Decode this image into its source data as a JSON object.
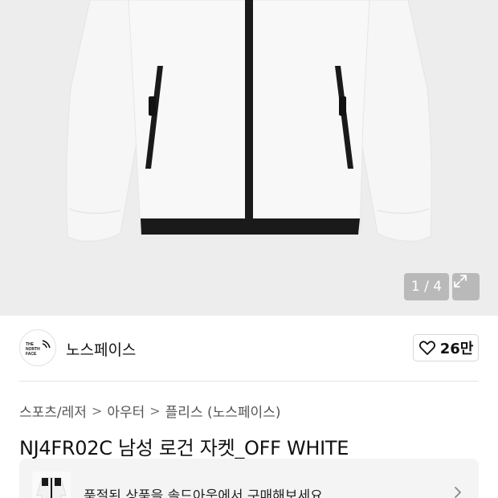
{
  "gallery": {
    "counter": "1 / 4",
    "expand_icon": "expand-arrows-icon",
    "image_desc_icon": "jacket-photo"
  },
  "brand": {
    "logo_text": "THE NORTH FACE",
    "name": "노스페이스",
    "like_icon": "heart-outline-icon",
    "like_count": "26만"
  },
  "breadcrumb": {
    "items": [
      "스포츠/레저",
      "아우터",
      "플리스 (노스페이스)"
    ],
    "separator": ">"
  },
  "product": {
    "title": "NJ4FR02C 남성 로건 자켓_OFF WHITE"
  },
  "soldout_banner": {
    "text": "품절된 상품을 솔드아웃에서 구매해보세요.",
    "chevron_icon": "chevron-right-icon"
  },
  "colors": {
    "hero_bg": "#ededed",
    "jacket": "#f7f7f7",
    "trim": "#1a1a1a"
  }
}
